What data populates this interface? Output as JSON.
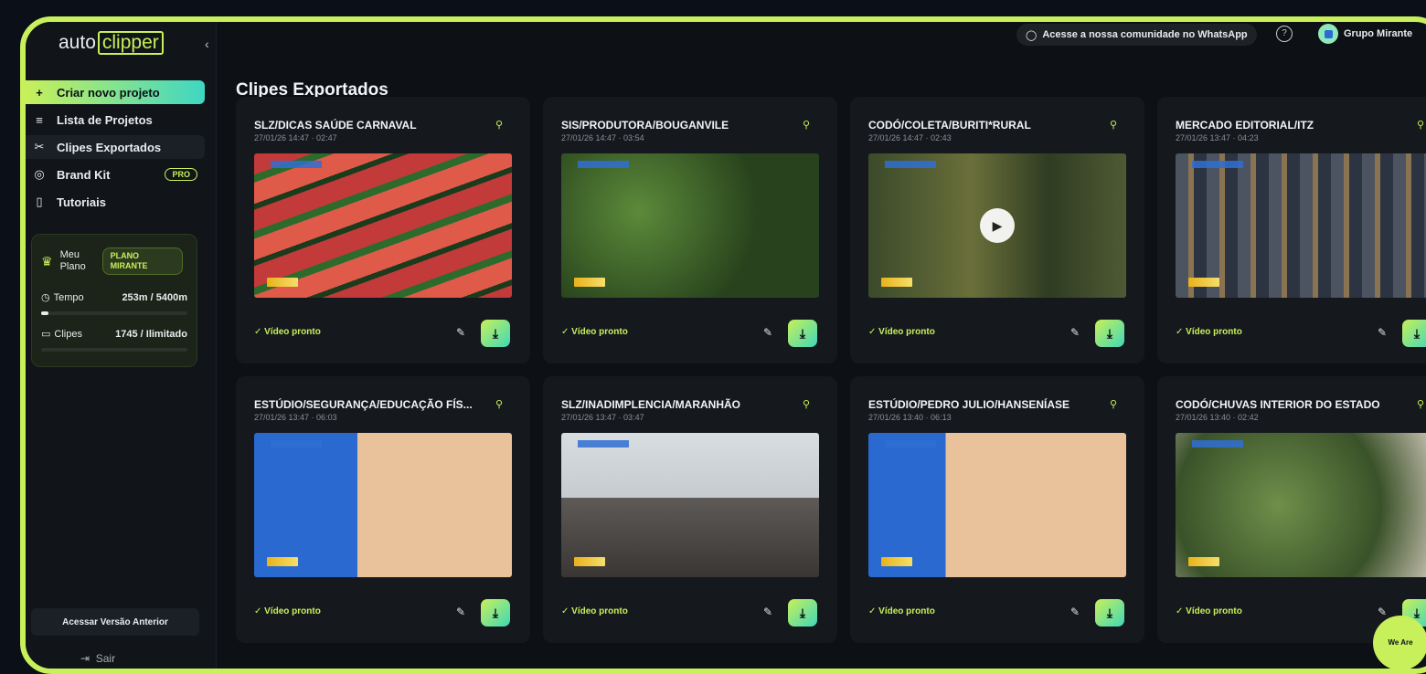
{
  "app": {
    "logo_left": "auto",
    "logo_right": "clipper",
    "collapse_icon": "chevron-left-icon"
  },
  "sidebar": {
    "items": [
      {
        "label": "Criar novo projeto",
        "icon": "+"
      },
      {
        "label": "Lista de Projetos",
        "icon": "≡"
      },
      {
        "label": "Clipes Exportados",
        "icon": "✂"
      },
      {
        "label": "Brand Kit",
        "icon": "◎",
        "badge": "PRO"
      },
      {
        "label": "Tutoriais",
        "icon": "▯"
      }
    ],
    "plan": {
      "label": "Meu Plano",
      "badge": "PLANO MIRANTE",
      "time_label": "Tempo",
      "time_value": "253m / 5400m",
      "time_fraction": 0.047,
      "clips_label": "Clipes",
      "clips_value": "1745 / Ilimitado",
      "clips_fraction": 0.0
    },
    "previous_version": "Acessar Versão Anterior",
    "logout": "Sair"
  },
  "header": {
    "whatsapp": "Acesse a nossa comunidade no WhatsApp",
    "help": "?",
    "org": "Grupo Mirante"
  },
  "main": {
    "title": "Clipes Exportados",
    "status_label": "✓ Vídeo pronto",
    "cards": [
      {
        "title": "SLZ/DICAS SAÚDE CARNAVAL",
        "meta": "27/01/26 14:47  ·  02:47",
        "thumb": "watermelon"
      },
      {
        "title": "SIS/PRODUTORA/BOUGANVILE",
        "meta": "27/01/26 14:47  ·  03:54",
        "thumb": "garden"
      },
      {
        "title": "CODÓ/COLETA/BURITI*RURAL",
        "meta": "27/01/26 14:47  ·  02:43",
        "thumb": "forest"
      },
      {
        "title": "MERCADO EDITORIAL/ITZ",
        "meta": "27/01/26 13:47  ·  04:23",
        "thumb": "library"
      },
      {
        "title": "ESTÚDIO/SEGURANÇA/EDUCAÇÃO FÍS...",
        "meta": "27/01/26 13:47  ·  06:03",
        "thumb": "studio1"
      },
      {
        "title": "SLZ/INADIMPLENCIA/MARANHÃO",
        "meta": "27/01/26 13:47  ·  03:47",
        "thumb": "office"
      },
      {
        "title": "ESTÚDIO/PEDRO JULIO/HANSENÍASE",
        "meta": "27/01/26 13:40  ·  06:13",
        "thumb": "studio2"
      },
      {
        "title": "CODÓ/CHUVAS INTERIOR DO ESTADO",
        "meta": "27/01/26 13:40  ·  02:42",
        "thumb": "trees"
      }
    ]
  },
  "colors": {
    "accent": "#c8f05a",
    "accent_2": "#41d8b8",
    "background": "#0d1014",
    "card": "#15191e"
  },
  "corner_badge": "We Are"
}
